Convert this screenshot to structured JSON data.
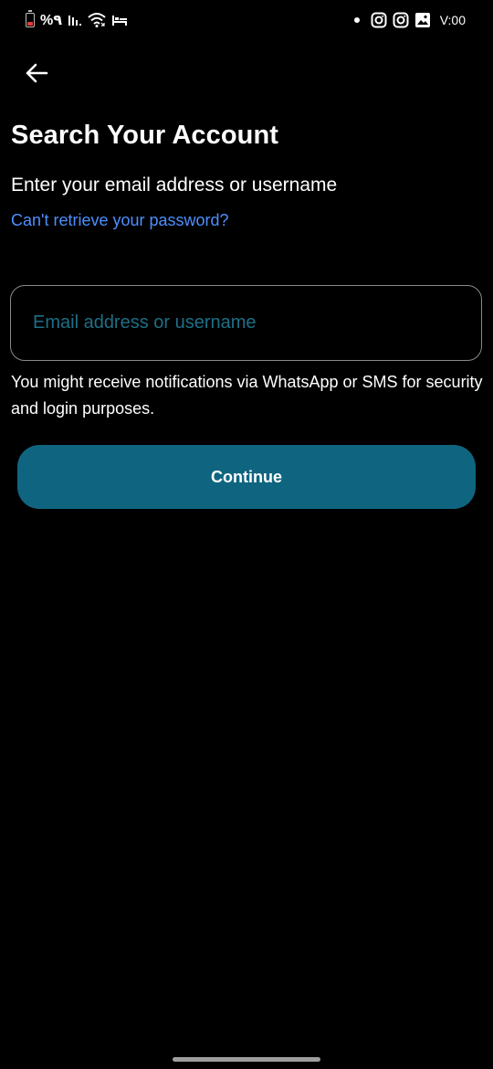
{
  "status_bar": {
    "battery_percent": "%٩",
    "time": "V:00",
    "icons": [
      "battery-icon",
      "signal-icon",
      "wifi-icon",
      "bed-icon",
      "dot-icon",
      "instagram-icon",
      "instagram-icon",
      "gallery-icon"
    ]
  },
  "header": {
    "back_icon": "arrow-left-icon"
  },
  "page": {
    "title": "Search Your Account",
    "subtitle": "Enter your email address or username",
    "help_link": "Can't retrieve your password?",
    "input": {
      "value": "",
      "placeholder": "Email address or username"
    },
    "notice": "You might receive notifications via WhatsApp or SMS for security and login purposes.",
    "continue_label": "Continue"
  },
  "colors": {
    "background": "#000000",
    "link": "#4d8fff",
    "button": "#0f6580",
    "placeholder": "#1e6f86",
    "input_border": "#8a8a8a"
  }
}
